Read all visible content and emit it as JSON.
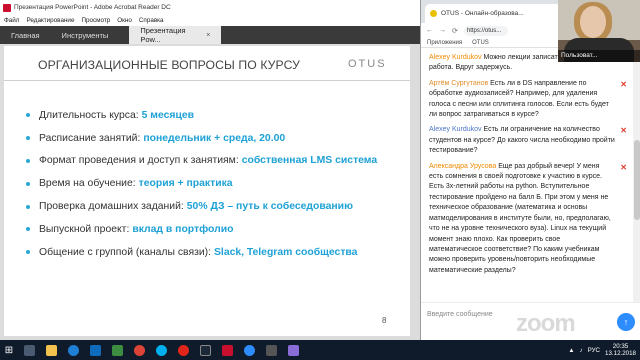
{
  "acrobat": {
    "window_title": "Презентация PowerPoint - Adobe Acrobat Reader DC",
    "menu": [
      "Файл",
      "Редактирование",
      "Просмотр",
      "Окно",
      "Справка"
    ],
    "tabs": {
      "home": "Главная",
      "tools": "Инструменты",
      "document": "Презентация Pow...",
      "close": "×"
    }
  },
  "slide": {
    "title": "ОРГАНИЗАЦИОННЫЕ ВОПРОСЫ ПО КУРСУ",
    "logo": "OTUS",
    "page_number": "8",
    "bullets": [
      {
        "label": "Длительность курса:",
        "value": "5 месяцев"
      },
      {
        "label": "Расписание занятий:",
        "value": "понедельник + среда, 20.00"
      },
      {
        "label": "Формат проведения и доступ к занятиям:",
        "value": "собственная LMS система"
      },
      {
        "label": "Время на обучение:",
        "value": "теория + практика"
      },
      {
        "label": "Проверка домашних заданий:",
        "value": "50% ДЗ – путь к собеседованию"
      },
      {
        "label": "Выпускной проект:",
        "value": "вклад в портфолио"
      },
      {
        "label": "Общение с группой (каналы связи):",
        "value": "Slack, Telegram сообщества"
      }
    ],
    "accent_color": "#1ea1d6"
  },
  "browser": {
    "tab_title": "OTUS - Онлайн-образова...",
    "url": "https://otus...",
    "bookmarks": [
      "Приложения",
      "OTUS"
    ],
    "profile": "Пользовател..."
  },
  "chat": {
    "messages": [
      {
        "author": "Alexey Kurdukov",
        "text": "Можно лекции записать? У меня работа. Вдруг задержусь.",
        "style": "orange"
      },
      {
        "author": "Артём Сургутанов",
        "text": "Есть ли в DS направление по обработке аудиозаписей? Например, для удаления голоса с песни или сплитинга голосов. Если есть будет ли вопрос затрагиваться в курсе?",
        "style": "orange2"
      },
      {
        "author": "Alexey Kurdukov",
        "text": "Есть ли ограничение на количество студентов на курсе? До какого числа необходимо пройти тестирование?",
        "style": "blue"
      },
      {
        "author": "Александра Урусова",
        "text": "Еще раз добрый вечер! У меня есть сомнения в своей подготовке к участию в курсе. Есть 3х-летний работы на python. Вступительное тестирование пройдено на балл Б. При этом у меня не техническое образование (математика и основы матмоделирования в институте были, но, предполагаю, что не на уровне технического вуза). Linux на текущий момент знаю плохо. Как проверить свое математическое соответствие? По каким учебникам можно проверить уровень/повторить необходимые математические разделы?",
        "style": "orange"
      }
    ],
    "input_placeholder": "Введите сообщение",
    "send_icon": "↑"
  },
  "webcam": {
    "name": "Пользоват..."
  },
  "watermark": "zoom",
  "taskbar": {
    "lang": "РУС",
    "time": "20:35",
    "date": "13.12.2018"
  }
}
